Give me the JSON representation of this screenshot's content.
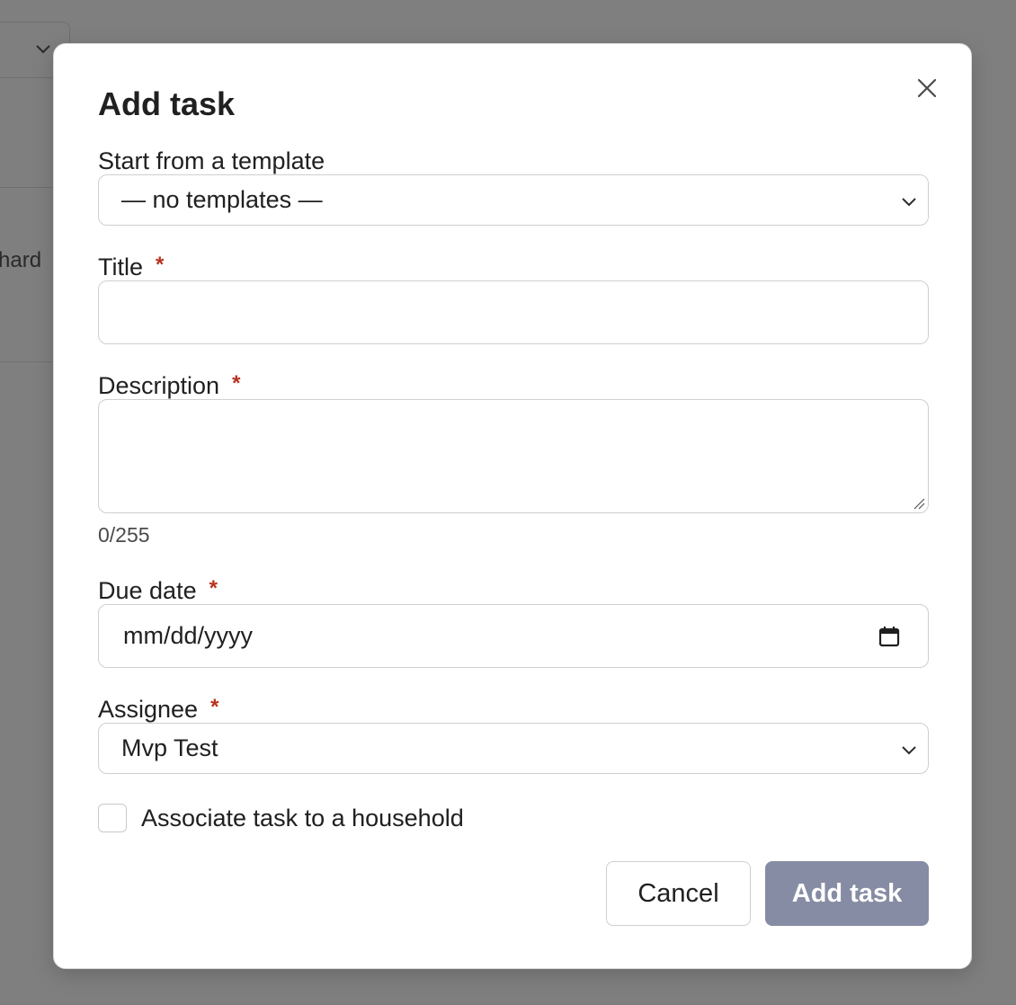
{
  "background": {
    "partial_text": "hard"
  },
  "modal": {
    "title": "Add task",
    "template": {
      "label": "Start from a template",
      "selected": "— no templates —"
    },
    "title_field": {
      "label": "Title",
      "required_mark": "*",
      "value": ""
    },
    "description": {
      "label": "Description",
      "required_mark": "*",
      "value": "",
      "counter": "0/255"
    },
    "due_date": {
      "label": "Due date",
      "required_mark": "*",
      "placeholder": "mm/dd/yyyy"
    },
    "assignee": {
      "label": "Assignee",
      "required_mark": "*",
      "selected": "Mvp Test"
    },
    "household_checkbox": {
      "label": "Associate task to a household",
      "checked": false
    },
    "buttons": {
      "cancel": "Cancel",
      "submit": "Add task"
    }
  },
  "colors": {
    "required": "#b8321f",
    "submit_bg": "#868ca3",
    "overlay": "#7f7f7f"
  },
  "icons": {
    "close": "close-icon",
    "chevron": "chevron-down-icon",
    "calendar": "calendar-icon"
  }
}
